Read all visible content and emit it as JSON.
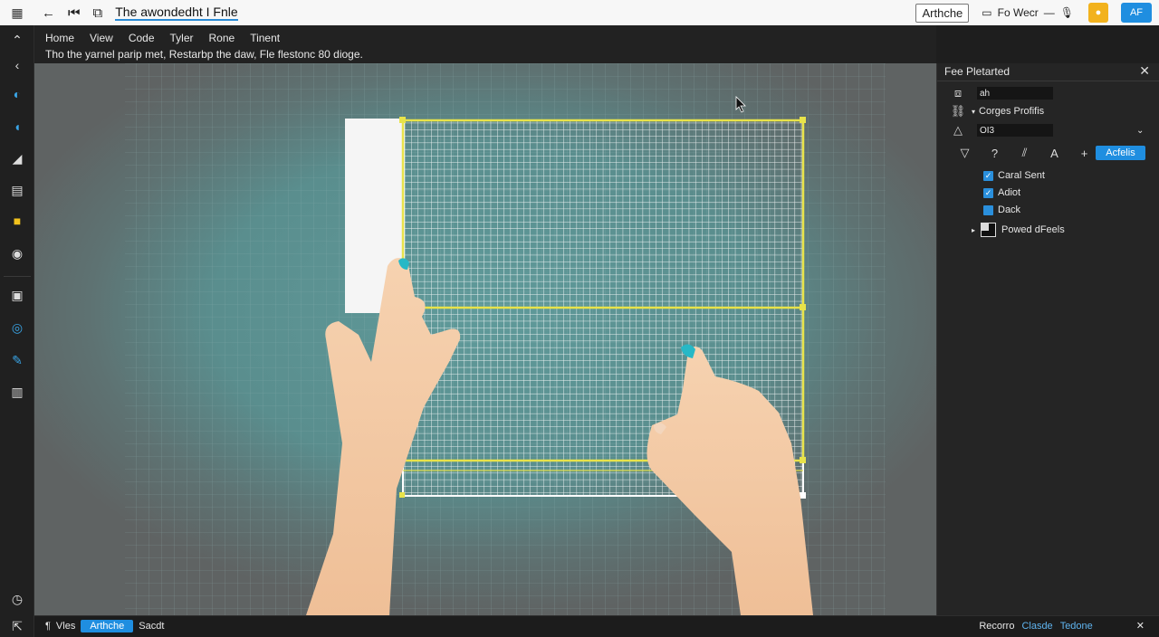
{
  "titlebar": {
    "apps_icon": "grid-icon",
    "title": "The awondedht I Fnle",
    "outline_button": "Arthche",
    "follow_label": "Fo Wecr",
    "mic_icon": "microphone-icon",
    "blue_button": "AF"
  },
  "menu": {
    "items": [
      "Home",
      "View",
      "Code",
      "Tyler",
      "Rone",
      "Tinent"
    ],
    "hint": "Tho the yarnel parip met, Restarbp the daw, Fle flestonc 80 dioge."
  },
  "right_panel": {
    "title": "Fee Pletarted",
    "field_1": "ah",
    "profile_label": "Corges Profifis",
    "field_2": "OI3",
    "apply_button": "Acfelis",
    "checks": [
      {
        "label": "Caral Sent",
        "checked": true
      },
      {
        "label": "Adiot",
        "checked": true
      },
      {
        "label": "Dack",
        "checked": false
      }
    ],
    "node_label": "Powed dFeels"
  },
  "statusbar": {
    "left_label": "Vles",
    "active_pill": "Arthche",
    "left_tail": "Sacdt",
    "right_1": "Recorro",
    "right_2": "Clasde",
    "right_3": "Tedone"
  },
  "colors": {
    "accent_blue": "#1f8ee0",
    "selection_yellow": "#e8e34a",
    "title_yellow": "#f2b21d"
  }
}
